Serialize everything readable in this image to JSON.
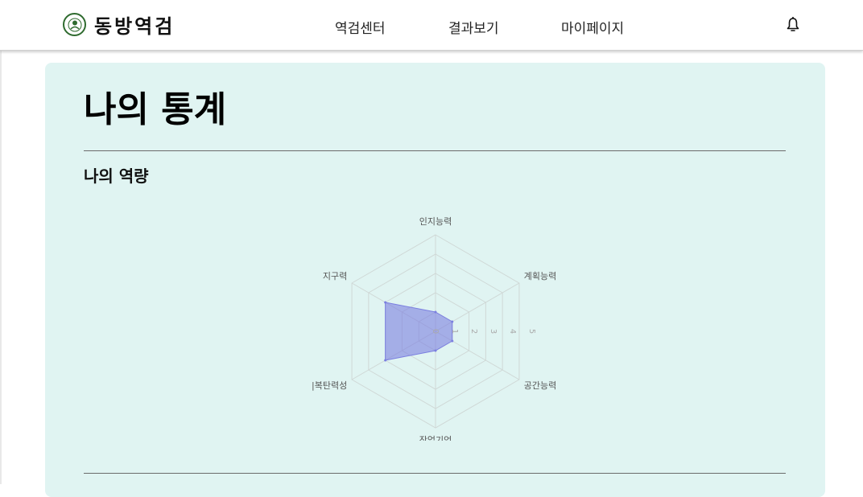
{
  "header": {
    "logo_text": "동방역검",
    "nav": [
      "역검센터",
      "결과보기",
      "마이페이지"
    ]
  },
  "main": {
    "title": "나의 통계",
    "section_title": "나의 역량"
  },
  "chart_data": {
    "type": "radar",
    "axes": [
      "인지능력",
      "계획능력",
      "공간능력",
      "작업기억",
      "|복탄력성",
      "지구력"
    ],
    "range": [
      0,
      5
    ],
    "ticks": [
      "0",
      "1",
      "2",
      "3",
      "4",
      "5"
    ],
    "series": [
      {
        "values": [
          1,
          1,
          1,
          1,
          3,
          3
        ],
        "color": "#7b7fe0"
      }
    ],
    "grid": true
  }
}
